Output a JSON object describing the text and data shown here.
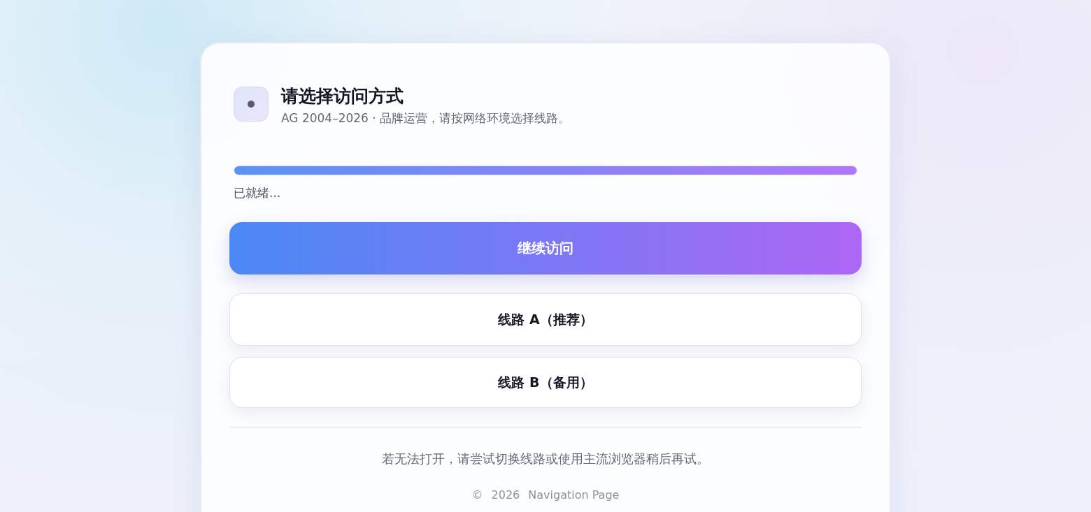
{
  "header": {
    "title": "请选择访问方式",
    "subtitle": "AG 2004–2026 · 品牌运营，请按网络环境选择线路。"
  },
  "progress": {
    "level": 1,
    "status": "已就绪..."
  },
  "primary_button": {
    "label": "继续访问"
  },
  "routes": [
    {
      "label": "线路 A（推荐）"
    },
    {
      "label": "线路 B（备用）"
    }
  ],
  "note": "若无法打开，请尝试切换线路或使用主流浏览器稍后再试。",
  "footer": [
    "©",
    "2026",
    "Navigation Page"
  ]
}
